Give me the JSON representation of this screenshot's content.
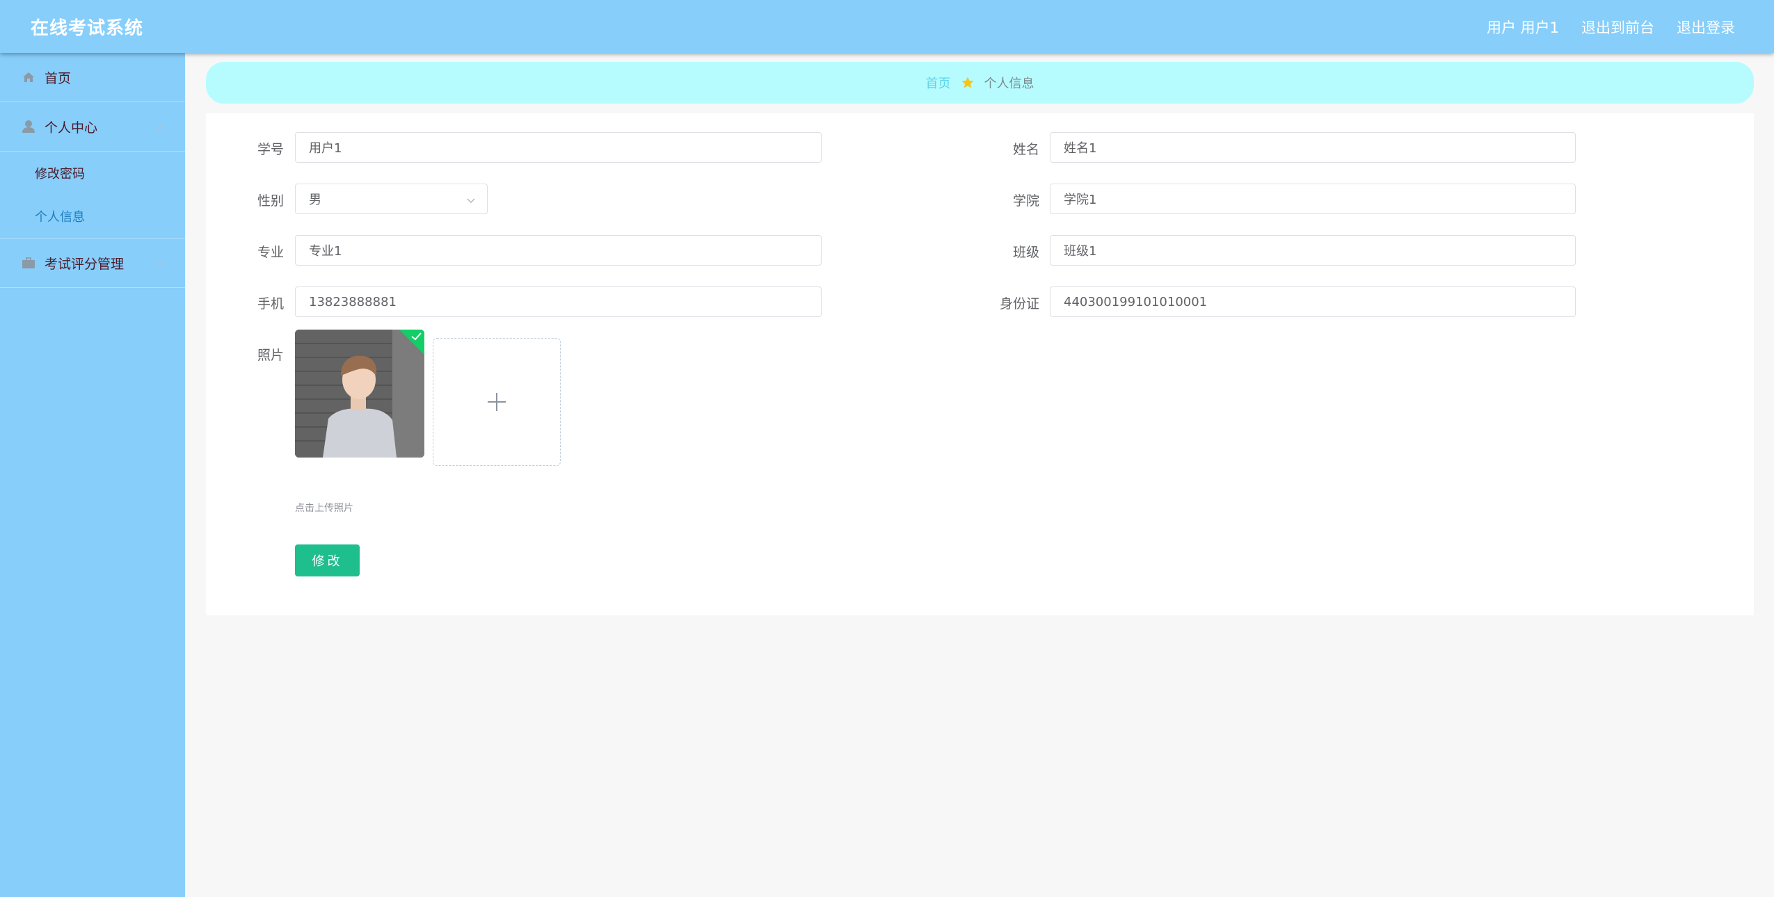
{
  "header": {
    "app_title": "在线考试系统",
    "user_label": "用户 用户1",
    "back_to_front": "退出到前台",
    "logout": "退出登录"
  },
  "sidebar": {
    "items": [
      {
        "label": "首页",
        "icon": "home-icon"
      },
      {
        "label": "个人中心",
        "icon": "user-icon",
        "expanded": true,
        "children": [
          {
            "label": "修改密码"
          },
          {
            "label": "个人信息",
            "active": true
          }
        ]
      },
      {
        "label": "考试评分管理",
        "icon": "briefcase-icon",
        "expanded": false
      }
    ]
  },
  "breadcrumb": {
    "home": "首页",
    "current": "个人信息",
    "icon": "star-icon"
  },
  "form": {
    "fields": {
      "student_no": {
        "label": "学号",
        "value": "用户1"
      },
      "name": {
        "label": "姓名",
        "value": "姓名1"
      },
      "gender": {
        "label": "性别",
        "value": "男"
      },
      "college": {
        "label": "学院",
        "value": "学院1"
      },
      "major": {
        "label": "专业",
        "value": "专业1"
      },
      "class": {
        "label": "班级",
        "value": "班级1"
      },
      "phone": {
        "label": "手机",
        "value": "13823888881"
      },
      "id_card": {
        "label": "身份证",
        "value": "440300199101010001"
      },
      "photo": {
        "label": "照片",
        "tip": "点击上传照片"
      }
    },
    "submit_label": "修改"
  },
  "colors": {
    "header_bg": "#87cefa",
    "sidebar_bg": "#87cefa",
    "breadcrumb_bg": "#b6fcff",
    "button_bg": "#1fbe8d",
    "star": "#f5c518"
  }
}
